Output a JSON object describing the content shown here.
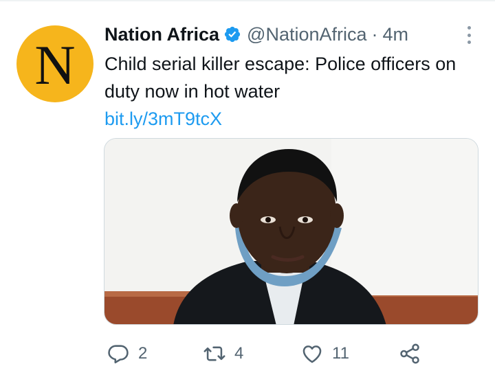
{
  "tweet": {
    "avatar_letter": "N",
    "display_name": "Nation Africa",
    "handle": "@NationAfrica",
    "separator": "·",
    "time": "4m",
    "text": "Child serial killer escape: Police officers on duty now in hot water",
    "link": "bit.ly/3mT9tcX"
  },
  "actions": {
    "reply_count": "2",
    "retweet_count": "4",
    "like_count": "11"
  },
  "icons": {
    "verified": "verified-badge-icon",
    "more": "more-vertical-icon",
    "reply": "reply-icon",
    "retweet": "retweet-icon",
    "like": "heart-icon",
    "share": "share-icon"
  },
  "colors": {
    "brand_blue": "#1d9bf0",
    "muted": "#536471",
    "avatar_bg": "#f6b51c"
  }
}
